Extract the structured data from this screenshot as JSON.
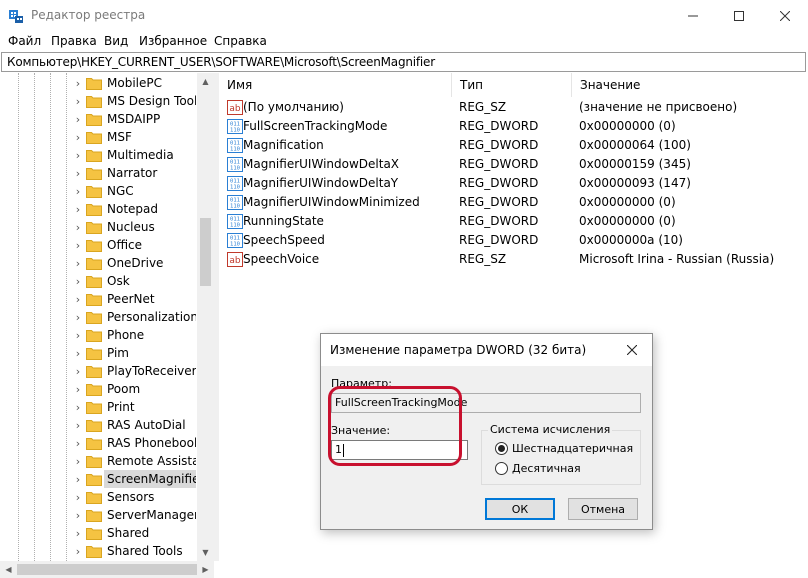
{
  "window": {
    "title": "Редактор реестра"
  },
  "menu": [
    "Файл",
    "Правка",
    "Вид",
    "Избранное",
    "Справка"
  ],
  "address": "Компьютер\\HKEY_CURRENT_USER\\SOFTWARE\\Microsoft\\ScreenMagnifier",
  "tree": {
    "items": [
      {
        "label": "MobilePC"
      },
      {
        "label": "MS Design Tools"
      },
      {
        "label": "MSDAIPP"
      },
      {
        "label": "MSF"
      },
      {
        "label": "Multimedia"
      },
      {
        "label": "Narrator"
      },
      {
        "label": "NGC"
      },
      {
        "label": "Notepad"
      },
      {
        "label": "Nucleus"
      },
      {
        "label": "Office"
      },
      {
        "label": "OneDrive"
      },
      {
        "label": "Osk"
      },
      {
        "label": "PeerNet"
      },
      {
        "label": "Personalization"
      },
      {
        "label": "Phone"
      },
      {
        "label": "Pim"
      },
      {
        "label": "PlayToReceiver"
      },
      {
        "label": "Poom"
      },
      {
        "label": "Print"
      },
      {
        "label": "RAS AutoDial"
      },
      {
        "label": "RAS Phonebook"
      },
      {
        "label": "Remote Assistance"
      },
      {
        "label": "ScreenMagnifier",
        "selected": true
      },
      {
        "label": "Sensors"
      },
      {
        "label": "ServerManager"
      },
      {
        "label": "Shared"
      },
      {
        "label": "Shared Tools"
      }
    ]
  },
  "list": {
    "columns": {
      "name": "Имя",
      "type": "Тип",
      "value": "Значение"
    },
    "rows": [
      {
        "name": "(По умолчанию)",
        "type": "REG_SZ",
        "value": "(значение не присвоено)",
        "icon": "string-value-icon"
      },
      {
        "name": "FullScreenTrackingMode",
        "type": "REG_DWORD",
        "value": "0x00000000 (0)",
        "icon": "binary-value-icon"
      },
      {
        "name": "Magnification",
        "type": "REG_DWORD",
        "value": "0x00000064 (100)",
        "icon": "binary-value-icon"
      },
      {
        "name": "MagnifierUIWindowDeltaX",
        "type": "REG_DWORD",
        "value": "0x00000159 (345)",
        "icon": "binary-value-icon"
      },
      {
        "name": "MagnifierUIWindowDeltaY",
        "type": "REG_DWORD",
        "value": "0x00000093 (147)",
        "icon": "binary-value-icon"
      },
      {
        "name": "MagnifierUIWindowMinimized",
        "type": "REG_DWORD",
        "value": "0x00000000 (0)",
        "icon": "binary-value-icon"
      },
      {
        "name": "RunningState",
        "type": "REG_DWORD",
        "value": "0x00000000 (0)",
        "icon": "binary-value-icon"
      },
      {
        "name": "SpeechSpeed",
        "type": "REG_DWORD",
        "value": "0x0000000a (10)",
        "icon": "binary-value-icon"
      },
      {
        "name": "SpeechVoice",
        "type": "REG_SZ",
        "value": "Microsoft Irina - Russian (Russia)",
        "icon": "string-value-icon"
      }
    ]
  },
  "dialog": {
    "title": "Изменение параметра DWORD (32 бита)",
    "param_label": "Параметр:",
    "param_value": "FullScreenTrackingMode",
    "value_label": "Значение:",
    "value_input": "1",
    "base_group": "Система исчисления",
    "radio_hex": "Шестнадцатеричная",
    "radio_dec": "Десятичная",
    "selected_base": "hex",
    "ok": "ОК",
    "cancel": "Отмена"
  },
  "colors": {
    "folder": "#f5c342",
    "highlight": "#c8102e",
    "accent": "#0078d7"
  }
}
